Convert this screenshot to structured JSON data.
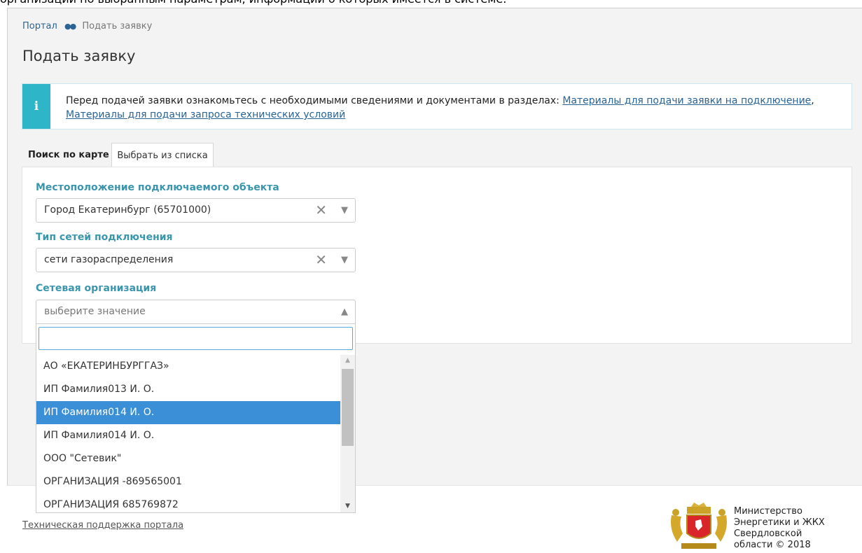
{
  "doc_overlay": {
    "top_text": "организации по выбранным параметрам, информации о которых имеется в системе."
  },
  "breadcrumb": {
    "home": "Портал",
    "current": "Подать заявку"
  },
  "page_title": "Подать заявку",
  "alert": {
    "icon": "info-icon",
    "text_prefix": "Перед подачей заявки ознакомьтесь с необходимыми сведениями и документами в разделах: ",
    "link1": "Материалы для подачи заявки на подключение",
    "separator": ", ",
    "link2": "Материалы для подачи запроса технических условий"
  },
  "tabs": [
    {
      "label": "Поиск по карте",
      "active": false
    },
    {
      "label": "Выбрать из списка",
      "active": true
    }
  ],
  "form": {
    "location": {
      "label": "Местоположение подключаемого объекта",
      "value": "Город Екатеринбург (65701000)"
    },
    "network_type": {
      "label": "Тип сетей подключения",
      "value": "сети газораспределения"
    },
    "organization": {
      "label": "Сетевая организация",
      "placeholder": "выберите значение",
      "search_value": "",
      "options": [
        "АО «ЕКАТЕРИНБУРГГАЗ»",
        "ИП Фамилия013 И. О.",
        "ИП Фамилия014 И. О.",
        "ИП Фамилия014 И. О.",
        "ООО \"Сетевик\"",
        "ОРГАНИЗАЦИЯ -869565001",
        "ОРГАНИЗАЦИЯ 685769872"
      ],
      "highlighted_index": 2
    }
  },
  "footer": {
    "support_link": "Техническая поддержка портала",
    "ministry": [
      "Министерство",
      "Энергетики и ЖКХ",
      "Свердловской",
      "области © 2018"
    ]
  },
  "colors": {
    "accent": "#3a96ad",
    "info": "#2fb5c8",
    "highlight": "#3a8fd6"
  }
}
